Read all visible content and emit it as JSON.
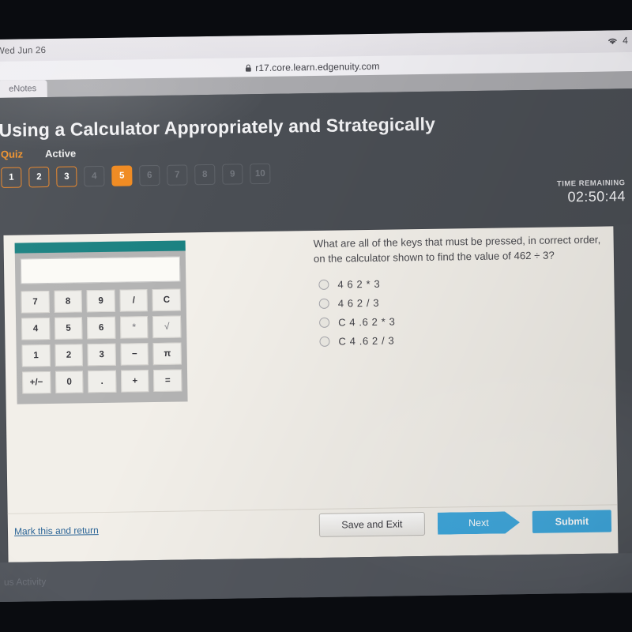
{
  "os_bar": {
    "date": "Wed Jun 26",
    "wifi_icon": "wifi-icon",
    "battery": "4"
  },
  "browser": {
    "lock_icon": "lock-icon",
    "url": "r17.core.learn.edgenuity.com",
    "tab_label": "eNotes"
  },
  "header": {
    "lesson_title": "Using a Calculator Appropriately and Strategically",
    "assignment_type": "Quiz",
    "status": "Active",
    "timer_label": "TIME REMAINING",
    "timer_value": "02:50:44",
    "accent_color": "#f08a20"
  },
  "question_nav": [
    {
      "number": "1",
      "state": "done"
    },
    {
      "number": "2",
      "state": "done"
    },
    {
      "number": "3",
      "state": "done"
    },
    {
      "number": "4",
      "state": "locked"
    },
    {
      "number": "5",
      "state": "current"
    },
    {
      "number": "6",
      "state": "locked"
    },
    {
      "number": "7",
      "state": "locked"
    },
    {
      "number": "8",
      "state": "locked"
    },
    {
      "number": "9",
      "state": "locked"
    },
    {
      "number": "10",
      "state": "locked"
    }
  ],
  "calculator": {
    "display_value": "",
    "header_color": "#1a8181",
    "rows": [
      [
        "7",
        "8",
        "9",
        "/",
        "C"
      ],
      [
        "4",
        "5",
        "6",
        "*",
        "√"
      ],
      [
        "1",
        "2",
        "3",
        "−",
        "π"
      ],
      [
        "+/−",
        "0",
        ".",
        "+",
        "="
      ]
    ]
  },
  "question": {
    "text": "What are all of the keys that must be pressed, in correct order, on the calculator shown to find the value of 462 ÷ 3?",
    "options": [
      {
        "label": "4 6 2 * 3",
        "selected": false
      },
      {
        "label": "4 6 2 / 3",
        "selected": false
      },
      {
        "label": "C 4 .6 2 * 3",
        "selected": false
      },
      {
        "label": "C 4 .6 2 / 3",
        "selected": false
      }
    ]
  },
  "footer": {
    "mark_link": "Mark this and return",
    "save_label": "Save and Exit",
    "next_label": "Next",
    "submit_label": "Submit",
    "button_color": "#38a5dc"
  },
  "page_bottom": {
    "ghost_text": "us Activity"
  }
}
